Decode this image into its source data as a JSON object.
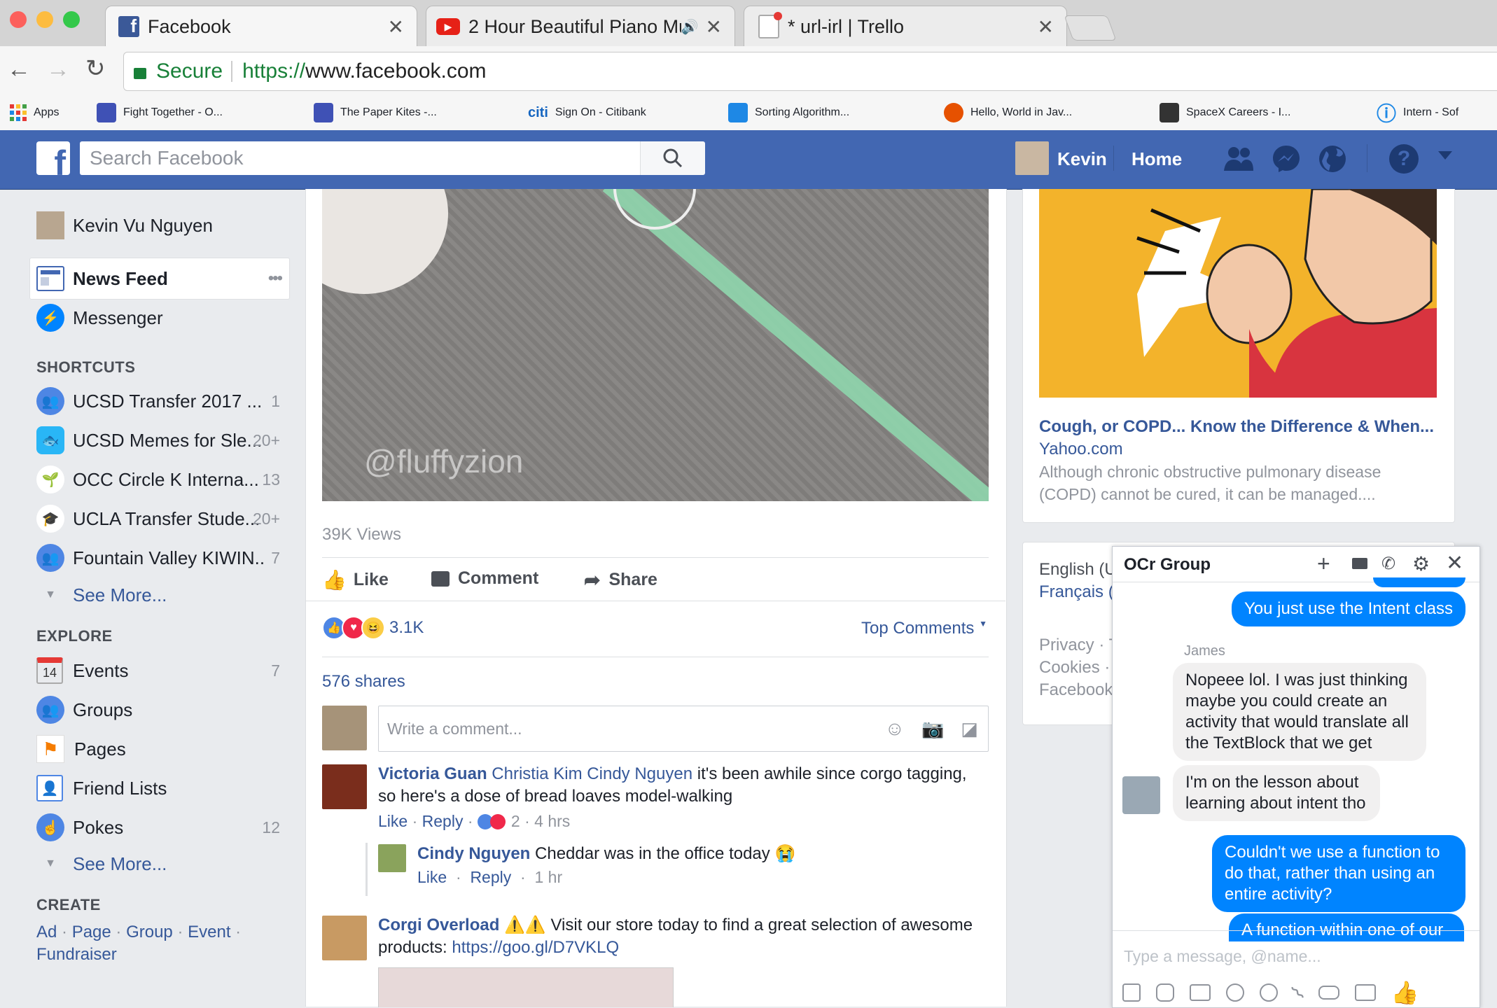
{
  "browser": {
    "tabs": [
      {
        "title": "Facebook",
        "active": true
      },
      {
        "title": "2 Hour Beautiful Piano Mus",
        "active": false
      },
      {
        "title": "* url-irl | Trello",
        "active": false
      }
    ],
    "secure_label": "Secure",
    "url_scheme": "https://",
    "url_host": "www.facebook.com",
    "bookmarks": [
      "Apps",
      "Fight Together - O...",
      "The Paper Kites -...",
      "Sign On - Citibank",
      "Sorting Algorithm...",
      "Hello, World in Jav...",
      "SpaceX Careers - I...",
      "Intern - Sof"
    ],
    "citi_label": "citi"
  },
  "fbbar": {
    "search_placeholder": "Search Facebook",
    "user_name": "Kevin",
    "home": "Home"
  },
  "leftnav": {
    "profile_name": "Kevin Vu Nguyen",
    "news_feed": "News Feed",
    "news_feed_more": "•••",
    "messenger": "Messenger",
    "shortcuts_header": "SHORTCUTS",
    "shortcuts": [
      {
        "label": "UCSD Transfer 2017 ...",
        "count": "1"
      },
      {
        "label": "UCSD Memes for Sle...",
        "count": "20+"
      },
      {
        "label": "OCC Circle K Interna...",
        "count": "13"
      },
      {
        "label": "UCLA Transfer Stude...",
        "count": "20+"
      },
      {
        "label": "Fountain Valley KIWIN..",
        "count": "7"
      }
    ],
    "see_more": "See More...",
    "explore_header": "EXPLORE",
    "explore": [
      {
        "label": "Events",
        "count": "7"
      },
      {
        "label": "Groups",
        "count": ""
      },
      {
        "label": "Pages",
        "count": ""
      },
      {
        "label": "Friend Lists",
        "count": ""
      },
      {
        "label": "Pokes",
        "count": "12"
      }
    ],
    "calendar_day": "14",
    "see_more_2": "See More...",
    "create_header": "CREATE",
    "create_links": [
      "Ad",
      "Page",
      "Group",
      "Event",
      "Fundraiser"
    ]
  },
  "post": {
    "watermark": "@fluffyzion",
    "views": "39K Views",
    "like": "Like",
    "comment": "Comment",
    "share": "Share",
    "reaction_count": "3.1K",
    "top_comments": "Top Comments",
    "shares": "576 shares",
    "comment_placeholder": "Write a comment...",
    "comments": [
      {
        "author": "Victoria Guan",
        "tags": "Christia Kim Cindy Nguyen",
        "text": "it's been awhile since corgo tagging, so here's a dose of bread loaves model-walking",
        "like": "Like",
        "reply": "Reply",
        "reactions": "2",
        "time": "4 hrs"
      },
      {
        "author": "Cindy Nguyen",
        "text": "Cheddar was in the office today",
        "like": "Like",
        "reply": "Reply",
        "time": "1 hr"
      },
      {
        "author": "Corgi Overload",
        "text": "Visit our store today to find a great selection of awesome products:",
        "link": "https://goo.gl/D7VKLQ"
      }
    ]
  },
  "ad": {
    "title": "Cough, or COPD... Know the Difference & When...",
    "source": "Yahoo.com",
    "desc": "Although chronic obstructive pulmonary disease (COPD) cannot be cured, it can be managed...."
  },
  "footer": {
    "lang1": "English (U",
    "lang2": "Français (",
    "line1": "Privacy · T",
    "line2": "Cookies · ",
    "line3": "Facebook"
  },
  "chat": {
    "title": "OCr Group",
    "messages": [
      {
        "from": "me",
        "text": "You just use the Intent class"
      },
      {
        "from": "James",
        "sender_label": "James",
        "text": "Nopeee lol. I was just thinking maybe you could create an activity that would translate all the TextBlock that we get"
      },
      {
        "from": "James",
        "text": "I'm on the lesson about learning about intent tho"
      },
      {
        "from": "me",
        "text": "Couldn't we use a function to do that, rather than using an entire activity?"
      },
      {
        "from": "me",
        "text": "A function within one of our"
      }
    ],
    "input_placeholder": "Type a message, @name..."
  },
  "colors": {
    "fb_blue": "#4267b2",
    "link_blue": "#365899",
    "messenger_blue": "#0084ff",
    "secure_green": "#188038"
  }
}
